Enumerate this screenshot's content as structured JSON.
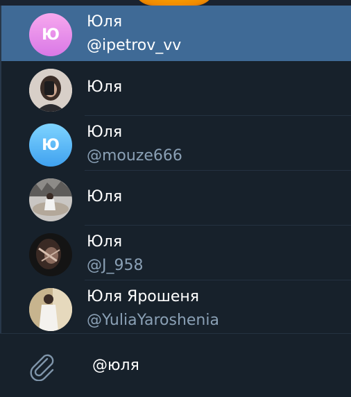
{
  "mentions": [
    {
      "name": "Юля",
      "handle": "@ipetrov_vv",
      "avatar": {
        "type": "letter",
        "letter": "Ю",
        "color": "#e08ff0"
      },
      "selected": true
    },
    {
      "name": "Юля",
      "handle": "",
      "avatar": {
        "type": "photo",
        "icon": "user-photo-mirror-selfie"
      },
      "selected": false
    },
    {
      "name": "Юля",
      "handle": "@mouze666",
      "avatar": {
        "type": "letter",
        "letter": "Ю",
        "color": "#5ab8f8"
      },
      "selected": false
    },
    {
      "name": "Юля",
      "handle": "",
      "avatar": {
        "type": "photo",
        "icon": "user-photo-outdoor"
      },
      "selected": false
    },
    {
      "name": "Юля",
      "handle": "@J_958",
      "avatar": {
        "type": "photo",
        "icon": "user-photo-dark-closeup"
      },
      "selected": false
    },
    {
      "name": "Юля Ярошеня",
      "handle": "@YuliaYaroshenia",
      "avatar": {
        "type": "photo",
        "icon": "user-photo-white-dress"
      },
      "selected": false
    }
  ],
  "composer": {
    "attach_icon": "paperclip-icon",
    "text": "@юля"
  },
  "colors": {
    "background": "#17212b",
    "selected_row": "#3f6a96",
    "handle_text": "#8aa0b5"
  }
}
